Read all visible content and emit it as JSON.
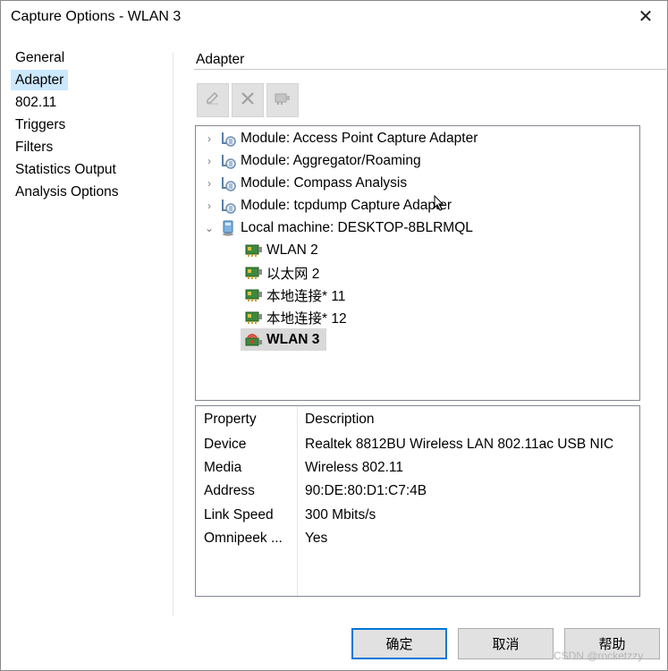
{
  "window": {
    "title": "Capture Options - WLAN 3",
    "close_icon": "close-icon"
  },
  "nav": {
    "items": [
      {
        "label": "General",
        "selected": false
      },
      {
        "label": "Adapter",
        "selected": true
      },
      {
        "label": "802.11",
        "selected": false
      },
      {
        "label": "Triggers",
        "selected": false
      },
      {
        "label": "Filters",
        "selected": false
      },
      {
        "label": "Statistics Output",
        "selected": false
      },
      {
        "label": "Analysis Options",
        "selected": false
      }
    ]
  },
  "adapter": {
    "section_title": "Adapter",
    "toolbar": [
      {
        "icon": "edit-icon"
      },
      {
        "icon": "delete-icon"
      },
      {
        "icon": "adapter-properties-icon"
      }
    ],
    "tree": [
      {
        "label": "Module: Access Point Capture Adapter",
        "icon": "module-icon",
        "expander": "collapsed"
      },
      {
        "label": "Module: Aggregator/Roaming",
        "icon": "module-icon",
        "expander": "collapsed"
      },
      {
        "label": "Module: Compass Analysis",
        "icon": "module-icon",
        "expander": "collapsed"
      },
      {
        "label": "Module: tcpdump Capture Adapter",
        "icon": "module-icon",
        "expander": "collapsed"
      },
      {
        "label": "Local machine: DESKTOP-8BLRMQL",
        "icon": "local-machine-icon",
        "expander": "expanded"
      },
      {
        "label": "WLAN 2",
        "icon": "network-card-icon"
      },
      {
        "label": "以太网 2",
        "icon": "network-card-icon"
      },
      {
        "label": "本地连接* 11",
        "icon": "network-card-icon"
      },
      {
        "label": "本地连接* 12",
        "icon": "network-card-icon"
      },
      {
        "label": "WLAN 3",
        "icon": "wireless-adapter-icon",
        "selected": true
      }
    ],
    "properties": {
      "header_property": "Property",
      "header_description": "Description",
      "rows": [
        {
          "property": "Device",
          "description": "Realtek 8812BU Wireless LAN 802.11ac USB NIC"
        },
        {
          "property": "Media",
          "description": "Wireless 802.11"
        },
        {
          "property": "Address",
          "description": "90:DE:80:D1:C7:4B"
        },
        {
          "property": "Link Speed",
          "description": "300 Mbits/s"
        },
        {
          "property": "Omnipeek ...",
          "description": "Yes"
        }
      ]
    }
  },
  "buttons": {
    "ok": "确定",
    "cancel": "取消",
    "help": "帮助"
  },
  "watermark": "CSDN @rocketzzy",
  "colors": {
    "selection": "#cce8ff",
    "default_button_border": "#0078d7",
    "button_face": "#e1e1e1"
  }
}
